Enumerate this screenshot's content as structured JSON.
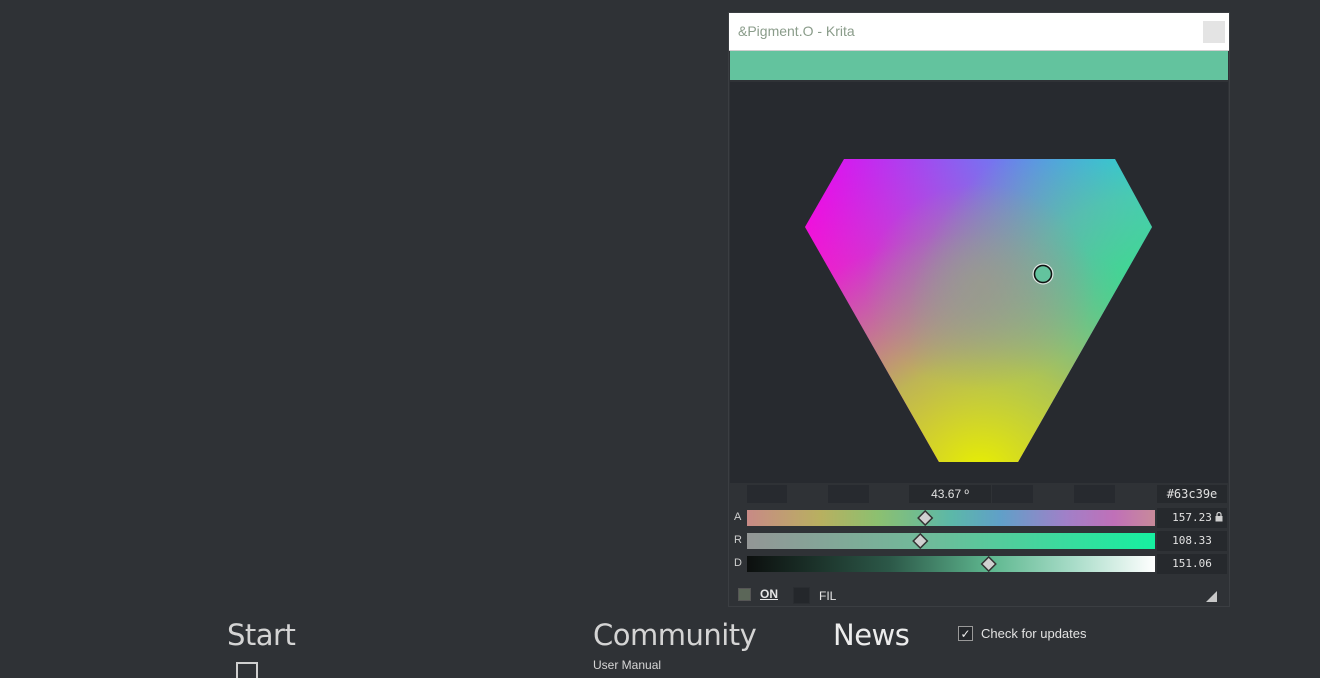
{
  "window": {
    "title": "&Pigment.O - Krita"
  },
  "colors": {
    "current": "#63c39e",
    "accent": "#63c39e",
    "panel_bg": "#272a2f",
    "app_bg": "#2f3236"
  },
  "pigment": {
    "hue_angle": "43.67 º",
    "hex": "#63c39e",
    "sliders": [
      {
        "label": "A",
        "value_text": "157.23",
        "value": 157.23,
        "max": 360,
        "locked": true
      },
      {
        "label": "R",
        "value_text": "108.33",
        "value": 108.33,
        "max": 255,
        "locked": false
      },
      {
        "label": "D",
        "value_text": "151.06",
        "value": 151.06,
        "max": 255,
        "locked": false
      }
    ],
    "toggles": [
      {
        "label": "ON",
        "checked": true
      },
      {
        "label": "FIL",
        "checked": false
      }
    ]
  },
  "welcome": {
    "start_heading": "Start",
    "community_heading": "Community",
    "user_manual_link": "User Manual",
    "news_heading": "News",
    "check_updates_label": "Check for updates",
    "check_updates_checked": true
  },
  "icons": {
    "close": "close-icon",
    "lock": "lock-icon",
    "resize": "resize-grip-icon",
    "check": "checkmark-icon",
    "new_file": "new-file-icon"
  }
}
